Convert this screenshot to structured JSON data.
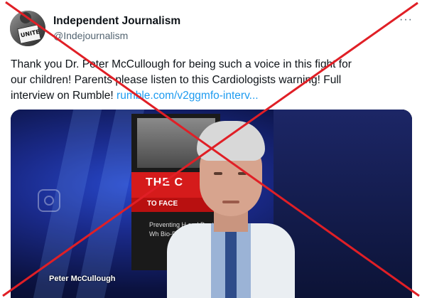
{
  "account": {
    "display_name": "Independent Journalism",
    "handle": "@Indejournalism",
    "avatar_sign_text": "UNITE"
  },
  "menu": {
    "more_glyph": "···"
  },
  "tweet": {
    "text_line1": "Thank you Dr. Peter McCullough for being such a voice in this fight for",
    "text_line2": "our children! Parents please listen to this Cardiologists warning! Full",
    "text_line3_prefix": "interview on Rumble! ",
    "link": "rumble.com/v2ggmfo-interv..."
  },
  "video": {
    "caption": "Peter McCullough",
    "book_title_1": "THE C",
    "book_title_2": "TO FACE",
    "book_subtitle": "Preventing H and Death Wh Bio-Pharmaceu"
  },
  "overlay": {
    "cross_color": "#e01f26"
  }
}
